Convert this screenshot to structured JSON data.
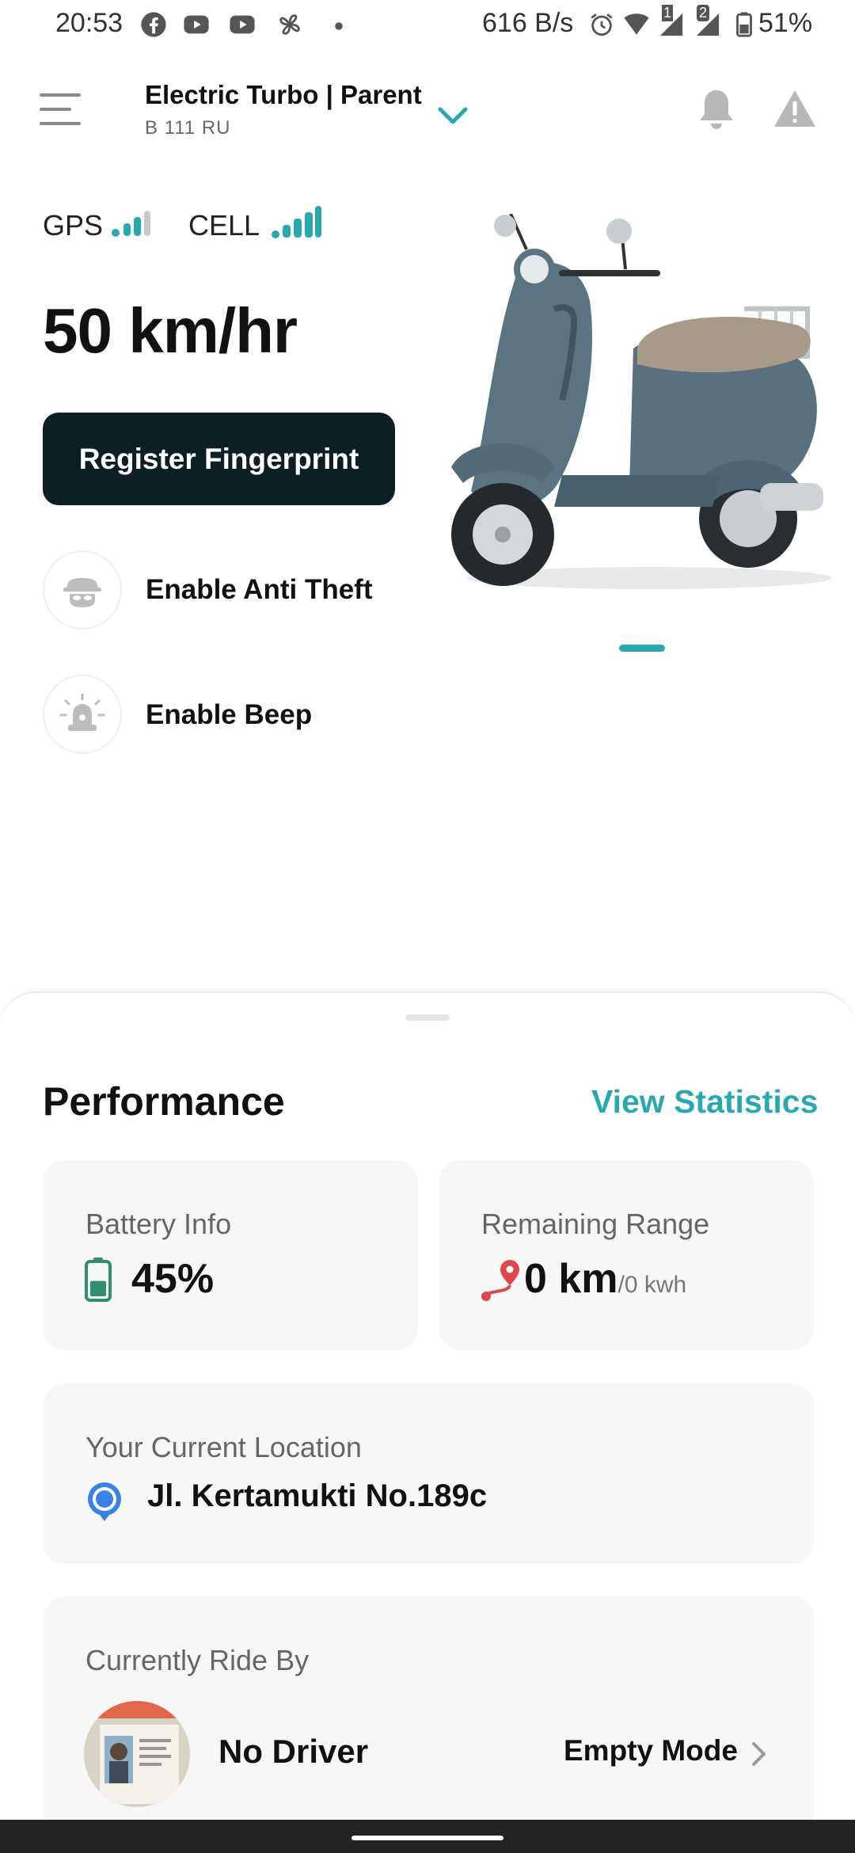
{
  "status_bar": {
    "time": "20:53",
    "network_speed": "616 B/s",
    "battery": "51%",
    "sim1_badge": "1",
    "sim2_badge": "2"
  },
  "header": {
    "vehicle_name": "Electric Turbo | Parent",
    "plate": "B 111 RU"
  },
  "signals": {
    "gps_label": "GPS",
    "cell_label": "CELL"
  },
  "speed": "50 km/hr",
  "actions": {
    "register_fingerprint": "Register Fingerprint",
    "anti_theft": "Enable Anti Theft",
    "beep": "Enable Beep"
  },
  "performance": {
    "title": "Performance",
    "view_statistics": "View Statistics",
    "battery_label": "Battery Info",
    "battery_value": "45%",
    "battery_level": 0.45,
    "range_label": "Remaining Range",
    "range_value": "0 km",
    "range_unit": "/0 kwh",
    "location_label": "Your Current Location",
    "location_value": "Jl. Kertamukti No.189c",
    "rider_label": "Currently Ride By",
    "rider_name": "No Driver",
    "mode": "Empty Mode"
  },
  "colors": {
    "accent": "#2aa8b0",
    "button_dark": "#0d1f23",
    "location_blue": "#3b82e6",
    "range_red": "#e0474c",
    "battery_green": "#2f8f6e"
  }
}
